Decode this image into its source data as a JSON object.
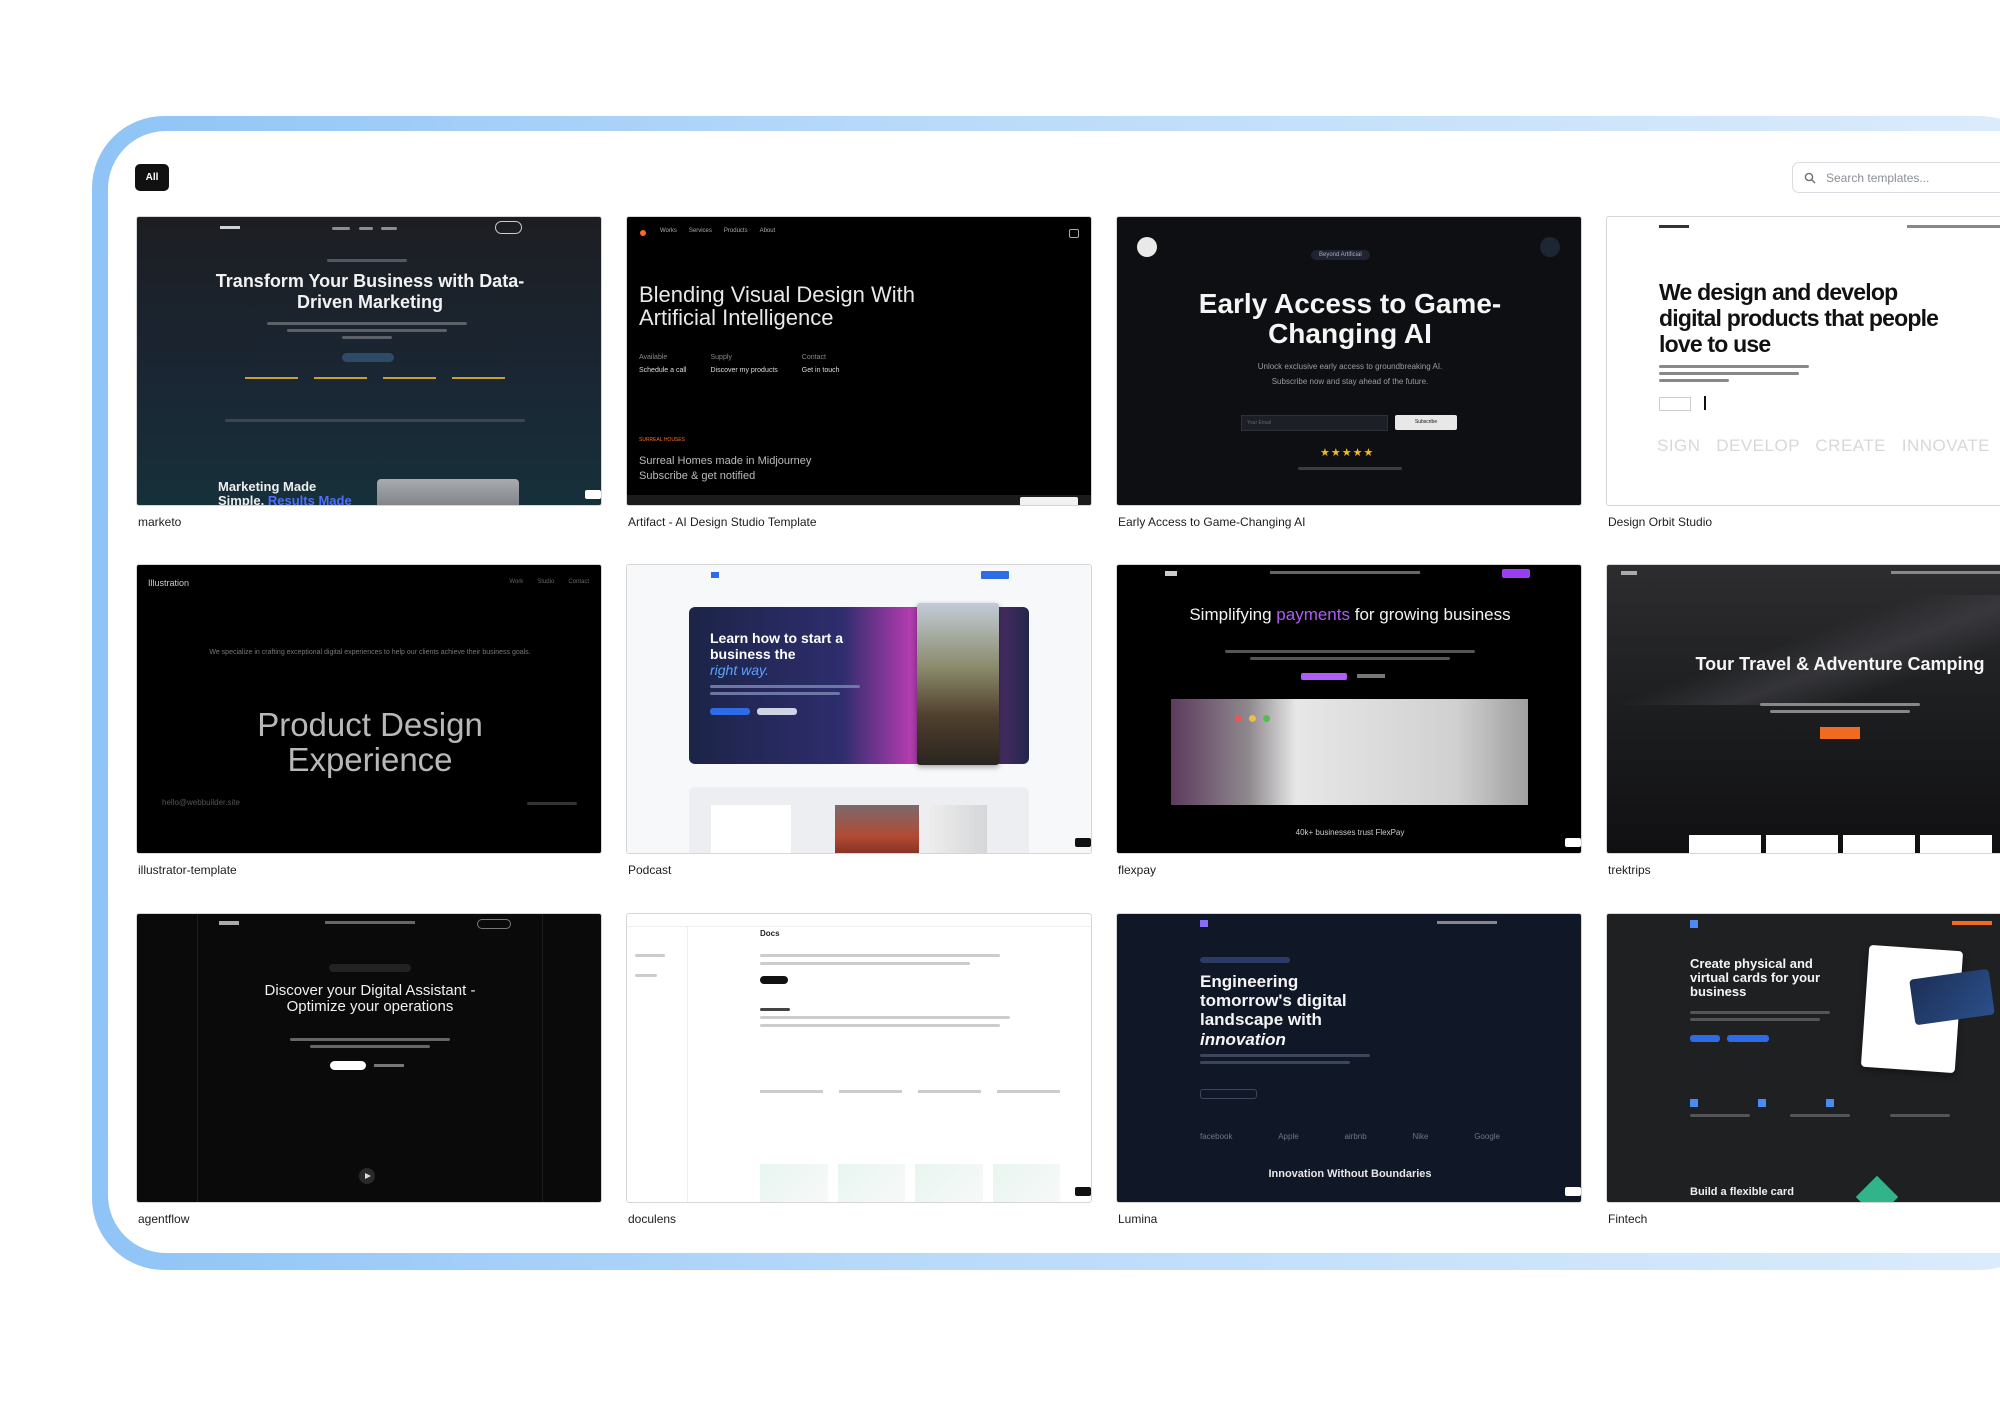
{
  "filters": {
    "all_label": "All"
  },
  "search": {
    "placeholder": "Search templates..."
  },
  "templates": [
    {
      "name": "marketo",
      "preview": {
        "headline": "Transform Your Business with Data-Driven Marketing",
        "footer_text": "Marketing Made",
        "footer_line2": "Simple.",
        "footer_accent": "Results Made"
      }
    },
    {
      "name": "Artifact - AI Design Studio Template",
      "preview": {
        "nav": [
          "Works",
          "Services",
          "Products",
          "About"
        ],
        "headline": "Blending Visual Design With Artificial Intelligence",
        "cols": [
          [
            "Available",
            "Schedule a call"
          ],
          [
            "Supply",
            "Discover my products"
          ],
          [
            "Contact",
            "Get in touch"
          ]
        ],
        "kicker": "SURREAL HOUSES",
        "subtext": "Surreal Homes made in Midjourney",
        "subtext2": "Subscribe & get notified"
      }
    },
    {
      "name": "Early Access to Game-Changing AI",
      "preview": {
        "badge": "Beyond Artificial",
        "headline": "Early Access to Game-Changing AI",
        "subtext": "Unlock exclusive early access to groundbreaking AI.",
        "subtext2": "Subscribe now and stay ahead of the future.",
        "input_placeholder": "Your Email",
        "button": "Subscribe",
        "stars": "★★★★★"
      }
    },
    {
      "name": "Design Orbit Studio",
      "preview": {
        "headline": "We design and develop digital products that people love to use",
        "marquee": "SIGN   DEVELOP   CREATE   INNOVATE"
      }
    },
    {
      "name": "illustrator-template",
      "preview": {
        "brand": "Illustration",
        "nav": [
          "Work",
          "Studio",
          "Contact"
        ],
        "intro": "We specialize in crafting exceptional digital experiences to help our clients achieve their business goals.",
        "headline": "Product Design Experience",
        "email": "hello@webbuilder.site"
      }
    },
    {
      "name": "Podcast",
      "preview": {
        "headline_1": "Learn how to start a business the",
        "headline_accent": "right way."
      }
    },
    {
      "name": "flexpay",
      "preview": {
        "headline_pre": "Simplifying",
        "headline_accent": "payments",
        "headline_post": "for growing business",
        "bottom": "40k+ businesses trust FlexPay"
      }
    },
    {
      "name": "trektrips",
      "preview": {
        "headline": "Tour Travel & Adventure Camping"
      }
    },
    {
      "name": "agentflow",
      "preview": {
        "headline": "Discover your Digital Assistant - Optimize your operations"
      }
    },
    {
      "name": "doculens",
      "preview": {
        "heading": "Docs"
      }
    },
    {
      "name": "Lumina",
      "preview": {
        "headline_1": "Engineering tomorrow's digital landscape with",
        "headline_accent": "innovation",
        "logos": [
          "facebook",
          "Apple",
          "airbnb",
          "Nike",
          "Google"
        ],
        "bottom": "Innovation Without Boundaries"
      }
    },
    {
      "name": "Fintech",
      "preview": {
        "headline": "Create physical and virtual cards for your business",
        "bottom": "Build a flexible card"
      }
    }
  ]
}
